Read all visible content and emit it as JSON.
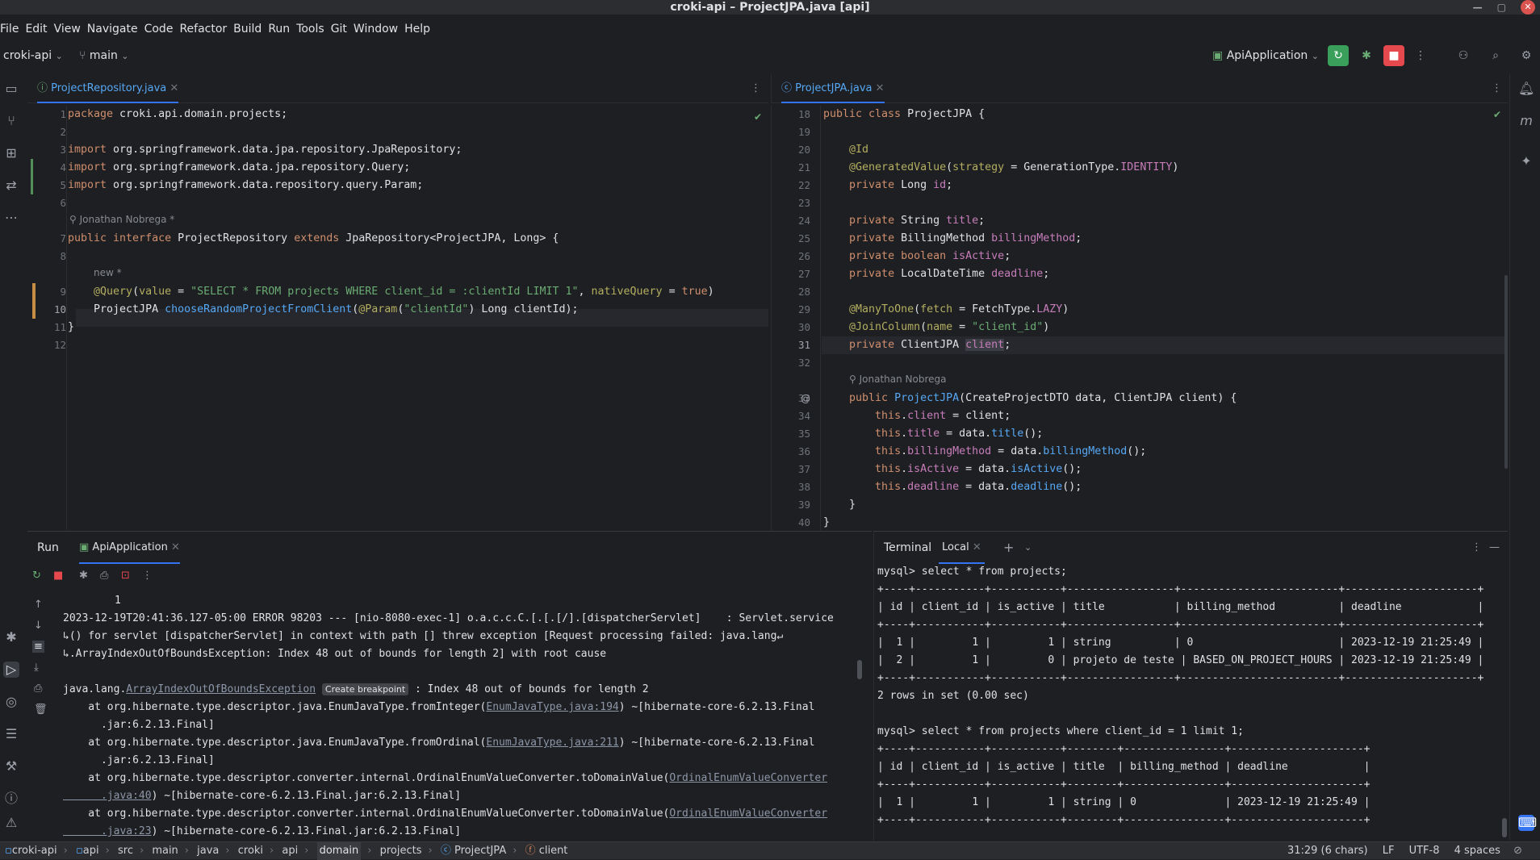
{
  "window": {
    "title": "croki-api – ProjectJPA.java [api]",
    "close_icon": "close-icon"
  },
  "menu": [
    "File",
    "Edit",
    "View",
    "Navigate",
    "Code",
    "Refactor",
    "Build",
    "Run",
    "Tools",
    "Git",
    "Window",
    "Help"
  ],
  "toolbar": {
    "project": "croki-api",
    "branch": "main",
    "run_config": "ApiApplication"
  },
  "left_editor": {
    "tab": "ProjectRepository.java",
    "author_hint": "Jonathan Nobrega *",
    "new_hint": "new *",
    "lines": [
      {
        "n": "1",
        "text": "package croki.api.domain.projects;"
      },
      {
        "n": "2",
        "text": ""
      },
      {
        "n": "3",
        "text": "import org.springframework.data.jpa.repository.JpaRepository;"
      },
      {
        "n": "4",
        "text": "import org.springframework.data.jpa.repository.Query;"
      },
      {
        "n": "5",
        "text": "import org.springframework.data.repository.query.Param;"
      },
      {
        "n": "6",
        "text": ""
      },
      {
        "n": "7",
        "text": "public interface ProjectRepository extends JpaRepository<ProjectJPA, Long> {"
      },
      {
        "n": "8",
        "text": ""
      },
      {
        "n": "9",
        "text": "    @Query(value = \"SELECT * FROM projects WHERE client_id = :clientId LIMIT 1\", nativeQuery = true)"
      },
      {
        "n": "10",
        "text": "    ProjectJPA chooseRandomProjectFromClient(@Param(\"clientId\") Long clientId);"
      },
      {
        "n": "11",
        "text": "}"
      },
      {
        "n": "12",
        "text": ""
      }
    ]
  },
  "right_editor": {
    "tab": "ProjectJPA.java",
    "author_hint": "Jonathan Nobrega",
    "lines": [
      {
        "n": "18",
        "text": "public class ProjectJPA {"
      },
      {
        "n": "19",
        "text": ""
      },
      {
        "n": "20",
        "text": "    @Id"
      },
      {
        "n": "21",
        "text": "    @GeneratedValue(strategy = GenerationType.IDENTITY)"
      },
      {
        "n": "22",
        "text": "    private Long id;"
      },
      {
        "n": "23",
        "text": ""
      },
      {
        "n": "24",
        "text": "    private String title;"
      },
      {
        "n": "25",
        "text": "    private BillingMethod billingMethod;"
      },
      {
        "n": "26",
        "text": "    private boolean isActive;"
      },
      {
        "n": "27",
        "text": "    private LocalDateTime deadline;"
      },
      {
        "n": "28",
        "text": ""
      },
      {
        "n": "29",
        "text": "    @ManyToOne(fetch = FetchType.LAZY)"
      },
      {
        "n": "30",
        "text": "    @JoinColumn(name = \"client_id\")"
      },
      {
        "n": "31",
        "text": "    private ClientJPA client;"
      },
      {
        "n": "32",
        "text": ""
      },
      {
        "n": "33",
        "text": "    public ProjectJPA(CreateProjectDTO data, ClientJPA client) {"
      },
      {
        "n": "34",
        "text": "        this.client = client;"
      },
      {
        "n": "35",
        "text": "        this.title = data.title();"
      },
      {
        "n": "36",
        "text": "        this.billingMethod = data.billingMethod();"
      },
      {
        "n": "37",
        "text": "        this.isActive = data.isActive();"
      },
      {
        "n": "38",
        "text": "        this.deadline = data.deadline();"
      },
      {
        "n": "39",
        "text": "    }"
      },
      {
        "n": "40",
        "text": "}"
      }
    ]
  },
  "run_panel": {
    "title": "Run",
    "tab": "ApiApplication",
    "lines": [
      "1",
      "2023-12-19T20:41:36.127-05:00 ERROR 98203 --- [nio-8080-exec-1] o.a.c.c.C.[.[.[/].[dispatcherServlet]    : Servlet.service",
      "() for servlet [dispatcherServlet] in context with path [] threw exception [Request processing failed: java.lang",
      ".ArrayIndexOutOfBoundsException: Index 48 out of bounds for length 2] with root cause",
      "",
      "java.lang.",
      "    at org.hibernate.type.descriptor.java.EnumJavaType.fromInteger(",
      "      .jar:6.2.13.Final]",
      "    at org.hibernate.type.descriptor.java.EnumJavaType.fromOrdinal(",
      "      .jar:6.2.13.Final]",
      "    at org.hibernate.type.descriptor.converter.internal.OrdinalEnumValueConverter.toDomainValue(",
      "      .java:40",
      "    at org.hibernate.type.descriptor.converter.internal.OrdinalEnumValueConverter.toDomainValue(",
      "      .java:23"
    ],
    "exception_link": "ArrayIndexOutOfBoundsException",
    "create_breakpoint": "Create breakpoint",
    "exception_tail": ": Index 48 out of bounds for length 2",
    "link1": "EnumJavaType.java:194",
    "tail1": ") ~[hibernate-core-6.2.13.Final",
    "link2": "EnumJavaType.java:211",
    "tail2": ") ~[hibernate-core-6.2.13.Final",
    "link3": "OrdinalEnumValueConverter",
    "tail3": ") ~[hibernate-core-6.2.13.Final.jar:6.2.13.Final]",
    "link4": "OrdinalEnumValueConverter",
    "tail4": ") ~[hibernate-core-6.2.13.Final.jar:6.2.13.Final]"
  },
  "terminal": {
    "title": "Terminal",
    "tab": "Local",
    "lines": [
      "mysql> select * from projects;",
      "+----+-----------+-----------+-----------------+-------------------------+---------------------+",
      "| id | client_id | is_active | title           | billing_method          | deadline            |",
      "+----+-----------+-----------+-----------------+-------------------------+---------------------+",
      "|  1 |         1 |         1 | string          | 0                       | 2023-12-19 21:25:49 |",
      "|  2 |         1 |         0 | projeto de teste | BASED_ON_PROJECT_HOURS | 2023-12-19 21:25:49 |",
      "+----+-----------+-----------+-----------------+-------------------------+---------------------+",
      "2 rows in set (0.00 sec)",
      "",
      "mysql> select * from projects where client_id = 1 limit 1;",
      "+----+-----------+-----------+--------+----------------+---------------------+",
      "| id | client_id | is_active | title  | billing_method | deadline            |",
      "+----+-----------+-----------+--------+----------------+---------------------+",
      "|  1 |         1 |         1 | string | 0              | 2023-12-19 21:25:49 |",
      "+----+-----------+-----------+--------+----------------+---------------------+"
    ]
  },
  "statusbar": {
    "crumbs": [
      "croki-api",
      "api",
      "src",
      "main",
      "java",
      "croki",
      "api",
      "domain",
      "projects",
      "ProjectJPA",
      "client"
    ],
    "position": "31:29 (6 chars)",
    "line_ending": "LF",
    "encoding": "UTF-8",
    "indent": "4 spaces"
  }
}
